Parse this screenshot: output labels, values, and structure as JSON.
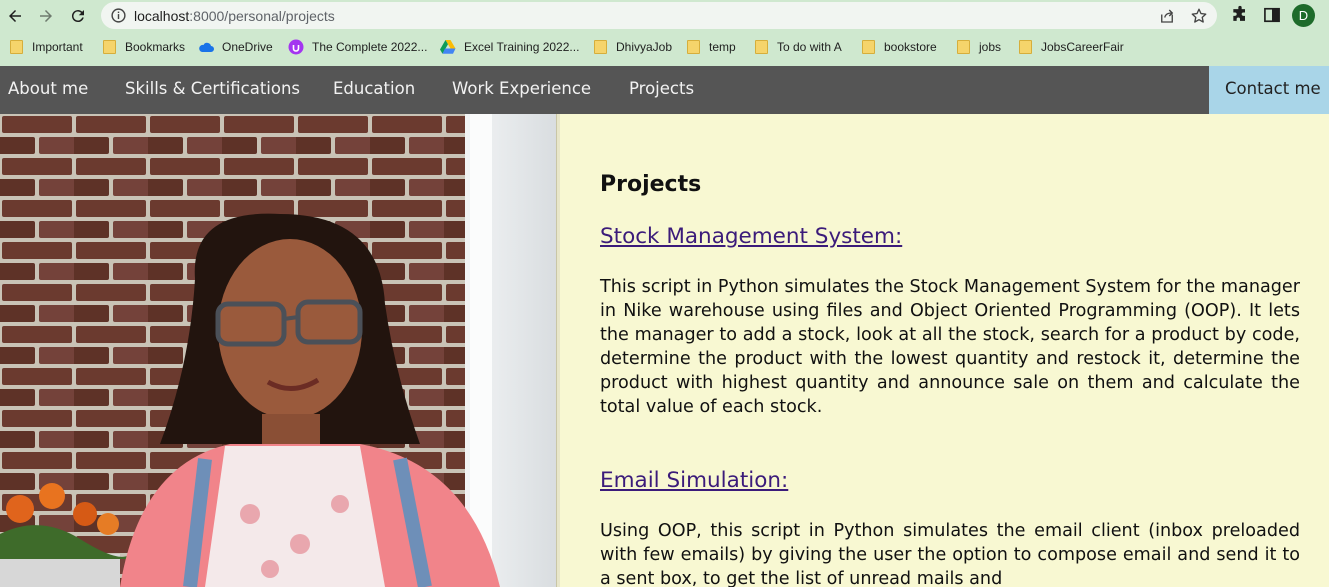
{
  "browser": {
    "url_host": "localhost",
    "url_rest": ":8000/personal/projects",
    "profile_initial": "D",
    "icons": [
      "back-icon",
      "forward-icon",
      "reload-icon",
      "info-icon",
      "share-icon",
      "star-icon",
      "extensions-icon",
      "sidepanel-icon"
    ]
  },
  "bookmarks": [
    {
      "label": "Important",
      "icon": "folder"
    },
    {
      "label": "Bookmarks",
      "icon": "folder"
    },
    {
      "label": "OneDrive",
      "icon": "cloud"
    },
    {
      "label": "The Complete 2022...",
      "icon": "udemy"
    },
    {
      "label": "Excel Training 2022...",
      "icon": "drive"
    },
    {
      "label": "DhivyaJob",
      "icon": "folder"
    },
    {
      "label": "temp",
      "icon": "folder"
    },
    {
      "label": "To do with A",
      "icon": "folder"
    },
    {
      "label": "bookstore",
      "icon": "folder"
    },
    {
      "label": "jobs",
      "icon": "folder"
    },
    {
      "label": "JobsCareerFair",
      "icon": "folder"
    }
  ],
  "nav": {
    "items": [
      "About me",
      "Skills & Certifications",
      "Education",
      "Work Experience",
      "Projects"
    ],
    "contact": "Contact me"
  },
  "content": {
    "title": "Projects",
    "projects": [
      {
        "title": "Stock Management System:",
        "description": "This script in Python simulates the Stock Management System for the manager in Nike warehouse using files and Object Oriented Programming (OOP). It lets the manager to add a stock, look at all the stock, search for a product by code, determine the product with the lowest quantity and restock it, determine the product with highest quantity and announce sale on them and calculate the total value of each stock."
      },
      {
        "title": "Email Simulation:",
        "description": "Using OOP, this script in Python simulates the email client (inbox preloaded with few emails) by giving the user the option to compose email and send it to a sent box, to get the list of unread mails and"
      }
    ]
  },
  "colors": {
    "chrome": "#cfe8cf",
    "nav_bg": "#555555",
    "contact_bg": "#a9d5e8",
    "content_bg": "#f8f8d2",
    "link": "#3b1b7a"
  }
}
